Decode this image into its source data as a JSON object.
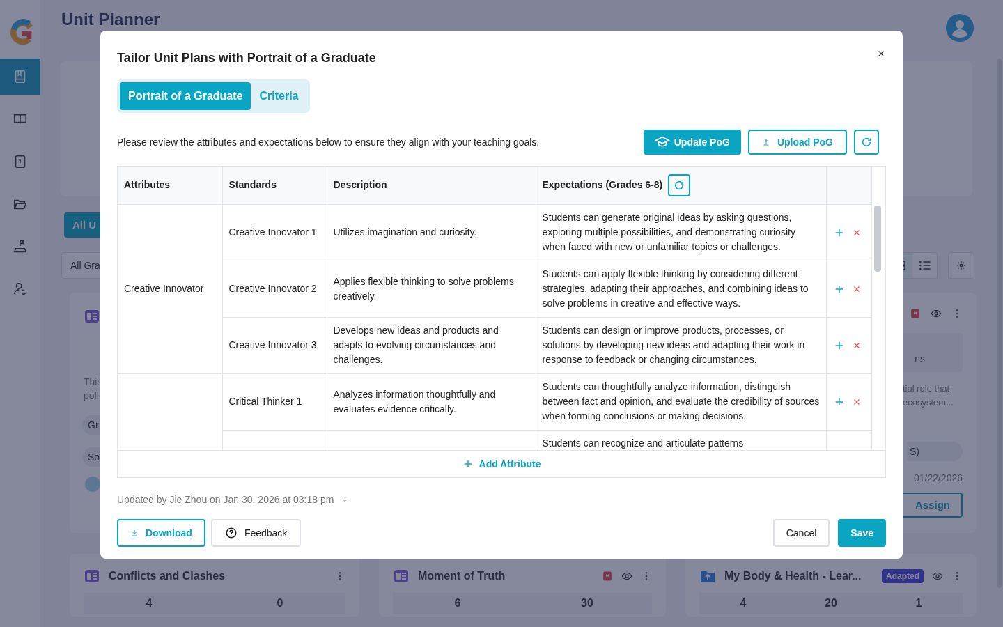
{
  "app": {
    "title": "Unit Planner"
  },
  "sidebar": {
    "items": [
      {
        "selected": true
      },
      {
        "selected": false
      },
      {
        "selected": false
      },
      {
        "selected": false
      },
      {
        "selected": false
      },
      {
        "selected": false
      }
    ]
  },
  "background": {
    "all_units_button": "All U",
    "grade_filter": "All Gra",
    "view_toggle": [
      {
        "selected": true
      },
      {
        "selected": false
      }
    ],
    "left_card": {
      "summary": [
        "This",
        "poll"
      ],
      "tags": [
        "Gr",
        "So"
      ]
    },
    "right_card": {
      "bookmarked": true,
      "stat_label": "ns",
      "summary": [
        "tial role that",
        "ecosystem..."
      ],
      "tag": "S)",
      "date": "01/22/2026",
      "button": "Assign"
    },
    "bottom_cards": [
      {
        "kind": "unit",
        "title": "Conflicts and Clashes",
        "bookmarked": false,
        "stats": [
          "4",
          "0"
        ]
      },
      {
        "kind": "unit",
        "title": "Moment of Truth",
        "bookmarked": true,
        "stats": [
          "6",
          "30"
        ]
      },
      {
        "kind": "folder",
        "title": "My Body & Health - Lear...",
        "badge": "Adapted",
        "bookmarked": false,
        "stats": [
          "4",
          "20",
          "1"
        ]
      }
    ]
  },
  "modal": {
    "title": "Tailor Unit Plans with Portrait of a Graduate",
    "tabs": [
      {
        "label": "Portrait of a Graduate",
        "selected": true
      },
      {
        "label": "Criteria",
        "selected": false
      }
    ],
    "intro": "Please review the attributes and expectations below to ensure they align with your teaching goals.",
    "actions": [
      {
        "kind": "primary",
        "label": "Update PoG"
      },
      {
        "kind": "outline",
        "label": "Upload PoG"
      },
      {
        "kind": "refresh"
      }
    ],
    "table": {
      "columns": [
        "Attributes",
        "Standards",
        "Description",
        "Expectations (Grades 6-8)"
      ],
      "groups": [
        {
          "attribute": "Creative Innovator",
          "rows": [
            {
              "standard": "Creative Innovator 1",
              "description": "Utilizes imagination and curiosity.",
              "expectation": "Students can generate original ideas by asking questions, exploring multiple possibilities, and demonstrating curiosity when faced with new or unfamiliar topics or challenges."
            },
            {
              "standard": "Creative Innovator 2",
              "description": "Applies flexible thinking to solve problems creatively.",
              "expectation": "Students can apply flexible thinking by considering different strategies, adapting their approaches, and combining ideas to solve problems in creative and effective ways."
            },
            {
              "standard": "Creative Innovator 3",
              "description": "Develops new ideas and products and adapts to evolving circumstances and challenges.",
              "expectation": "Students can design or improve products, processes, or solutions by developing new ideas and adapting their work in response to feedback or changing circumstances."
            }
          ]
        },
        {
          "rows": [
            {
              "standard": "Critical Thinker 1",
              "description": "Analyzes information thoughtfully and evaluates evidence critically.",
              "expectation": "Students can thoughtfully analyze information, distinguish between fact and opinion, and evaluate the credibility of sources when forming conclusions or making decisions."
            },
            {
              "expectation": "Students can recognize and articulate patterns"
            }
          ]
        }
      ]
    },
    "add_label": "Add Attribute",
    "updated": "Updated by Jie Zhou on Jan 30, 2026 at 03:18 pm",
    "footer_buttons": [
      {
        "kind": "download",
        "label": "Download"
      },
      {
        "kind": "feedback",
        "label": "Feedback"
      }
    ],
    "cancel": "Cancel",
    "save": "Save"
  }
}
